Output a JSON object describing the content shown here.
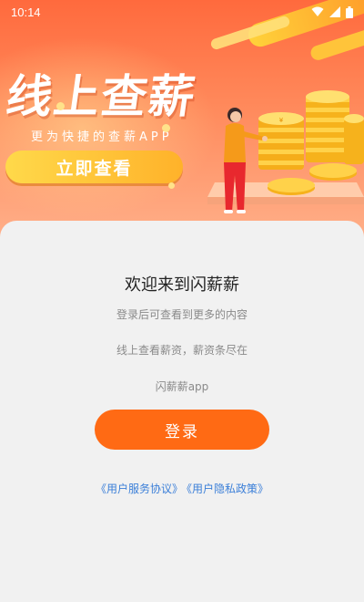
{
  "status_bar": {
    "time": "10:14"
  },
  "banner": {
    "headline": "线上查薪",
    "subline": "更为快捷的查薪APP",
    "cta_label": "立即查看",
    "colors": {
      "gradient_top": "#ff6a3d",
      "gradient_bottom": "#ffb08a",
      "cta": "#ffc83a"
    }
  },
  "welcome": {
    "title": "欢迎来到闪薪薪",
    "line1": "登录后可查看到更多的内容",
    "line2": "线上查看薪资，薪资条尽在",
    "line3": "闪薪薪app"
  },
  "login": {
    "label": "登录",
    "color": "#ff6a14"
  },
  "agreements": {
    "user_service": "《用户服务协议》",
    "privacy_policy": "《用户隐私政策》",
    "color": "#3b7fd8"
  },
  "icons": [
    "wifi-icon",
    "signal-icon",
    "battery-icon"
  ]
}
